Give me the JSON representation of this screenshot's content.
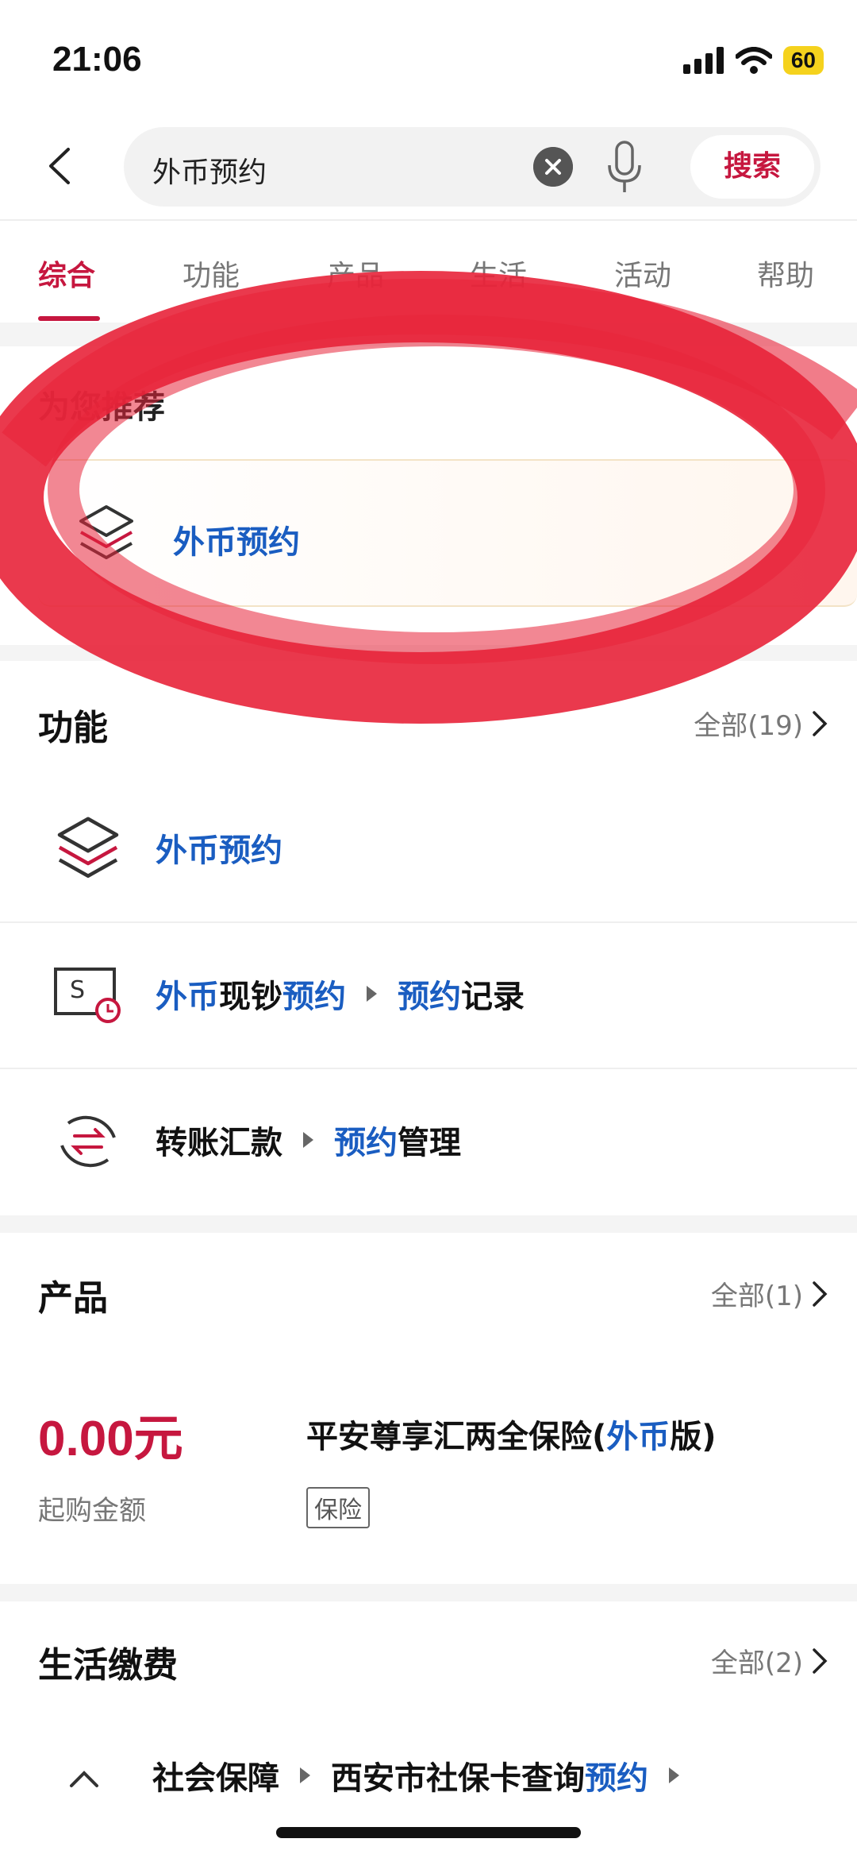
{
  "status_bar": {
    "time": "21:06",
    "battery": "60"
  },
  "search": {
    "query": "外币预约",
    "button": "搜索"
  },
  "tabs": [
    {
      "label": "综合",
      "active": true
    },
    {
      "label": "功能",
      "active": false
    },
    {
      "label": "产品",
      "active": false
    },
    {
      "label": "生活",
      "active": false
    },
    {
      "label": "活动",
      "active": false
    },
    {
      "label": "帮助",
      "active": false
    }
  ],
  "recommend": {
    "title": "为您推荐",
    "item": "外币预约"
  },
  "functions": {
    "title": "功能",
    "more": "全部(19)",
    "items": [
      {
        "parts": [
          "外币预约"
        ]
      },
      {
        "parts": [
          "外币",
          "现钞",
          "预约"
        ],
        "sub": [
          "预约",
          "记录"
        ]
      },
      {
        "parts": [
          "转账汇款"
        ],
        "sub": [
          "预约",
          "管理"
        ]
      }
    ]
  },
  "products": {
    "title": "产品",
    "more": "全部(1)",
    "price": "0.00元",
    "price_label": "起购金额",
    "name_prefix": "平安尊享汇两全保险(",
    "name_highlight": "外币",
    "name_suffix": "版)",
    "tag": "保险"
  },
  "life": {
    "title": "生活缴费",
    "more": "全部(2)",
    "item_a": "社会保障",
    "item_b_prefix": "西安市社保卡查询",
    "item_b_highlight": "预约"
  },
  "colors": {
    "accent": "#c6173f",
    "link": "#1a5dc1",
    "annotation": "#e8243a"
  }
}
